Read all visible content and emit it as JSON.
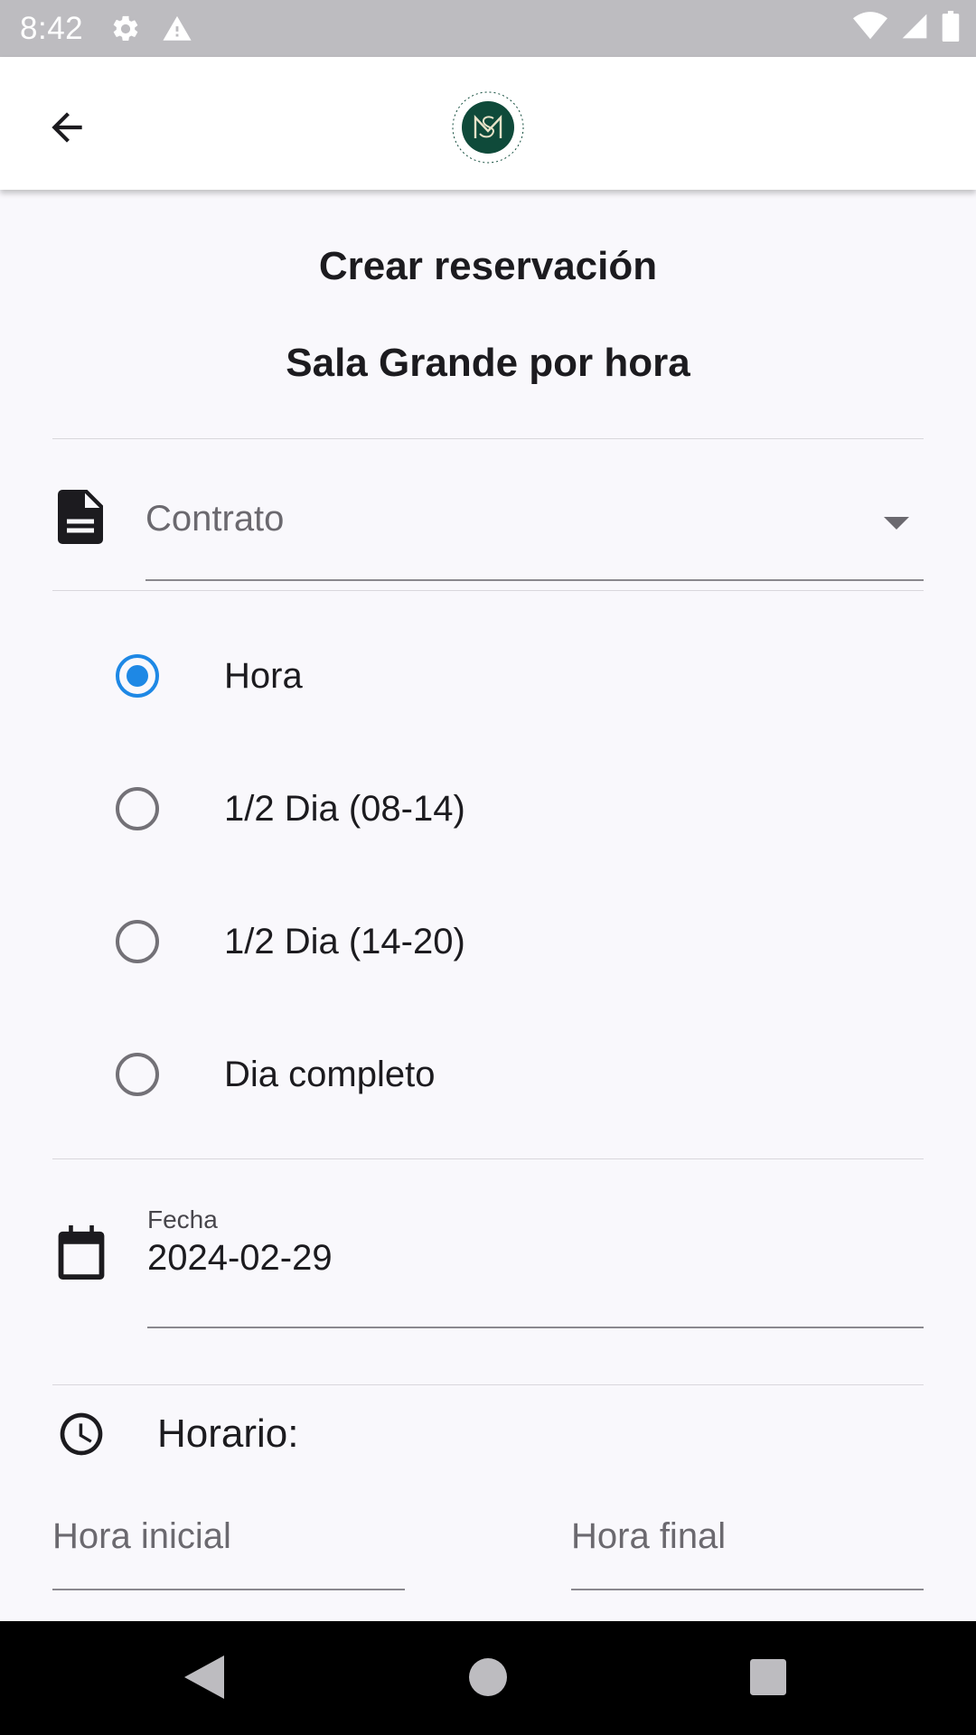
{
  "status_bar": {
    "time": "8:42",
    "icons": [
      "settings-icon",
      "warning-icon",
      "wifi-icon",
      "signal-icon",
      "battery-icon"
    ]
  },
  "app_bar": {
    "back_icon": "arrow-back-icon",
    "logo_icon": "estacion-san-miguel-logo"
  },
  "page": {
    "title": "Crear reservación",
    "subtitle": "Sala Grande por hora"
  },
  "contract": {
    "icon": "document-icon",
    "placeholder": "Contrato",
    "dropdown_icon": "dropdown-arrow-icon"
  },
  "booking_type": {
    "selected": "Hora",
    "options": [
      {
        "label": "Hora",
        "selected": true
      },
      {
        "label": "1/2 Dia (08-14)",
        "selected": false
      },
      {
        "label": "1/2 Dia (14-20)",
        "selected": false
      },
      {
        "label": "Dia completo",
        "selected": false
      }
    ]
  },
  "date": {
    "icon": "calendar-icon",
    "label": "Fecha",
    "value": "2024-02-29"
  },
  "schedule": {
    "icon": "clock-icon",
    "label": "Horario:",
    "start_placeholder": "Hora inicial",
    "end_placeholder": "Hora final"
  },
  "nav_bar": {
    "icons": [
      "nav-back-icon",
      "nav-home-icon",
      "nav-recents-icon"
    ]
  },
  "colors": {
    "accent": "#1e88e5",
    "background": "#f9f8fc",
    "logo_green": "#0f4a3a"
  }
}
